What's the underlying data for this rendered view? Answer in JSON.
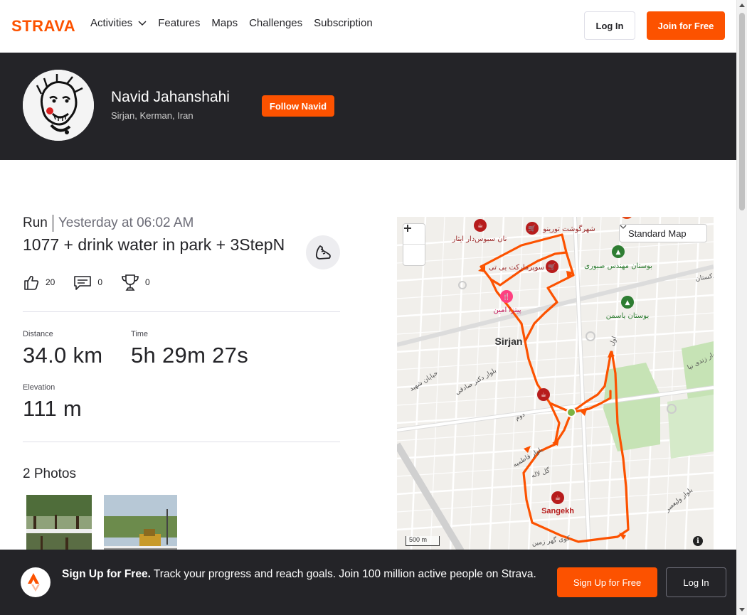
{
  "header": {
    "logo_text": "STRAVA",
    "nav": [
      "Activities",
      "Features",
      "Maps",
      "Challenges",
      "Subscription"
    ],
    "login_label": "Log In",
    "join_label": "Join for Free"
  },
  "athlete": {
    "name": "Navid Jahanshahi",
    "location": "Sirjan, Kerman, Iran",
    "follow_label": "Follow Navid"
  },
  "activity": {
    "type": "Run",
    "time": "Yesterday at 06:02 AM",
    "title": "1077 + drink water in park + 3StepN",
    "kudos": "20",
    "comments": "0",
    "achievements": "0",
    "stats": {
      "distance_label": "Distance",
      "distance_value": "34.0 km",
      "time_label": "Time",
      "time_value": "5h 29m 27s",
      "elevation_label": "Elevation",
      "elevation_value": "111 m"
    },
    "photos_title": "2 Photos"
  },
  "map": {
    "type_label": "Standard Map",
    "scale_label": "500 m",
    "city_label": "Sirjan",
    "sangekh_label": "Sangekh",
    "route_color": "#fc5200",
    "labels_fa": {
      "nan": "نان سبوس‌دار ایثار",
      "shahr_gosht": "شهرگوشت تورینو",
      "super": "سوپرمارکت بی تی",
      "bustan_saburi": "بوستان مهندس صبوری",
      "pizza": "پیتزا امین",
      "bustan_yasaman": "بوستان یاسمن",
      "shahid": "خیابان شهید",
      "sadeghi": "بلوار دکتر صادقی",
      "zandi": "بلوار زندی نیا",
      "fatemieh": "بلوار فاطمیه",
      "gol": "گل لاله",
      "gohar": "کوی گهر زمین",
      "valiasr": "بلوار ولیعصر",
      "dorm": "دوم",
      "avval": "اول",
      "kudakestan": "کودکستان"
    }
  },
  "signup": {
    "bold": "Sign Up for Free.",
    "text": " Track your progress and reach goals. Join 100 million active people on Strava.",
    "signup_label": "Sign Up for Free",
    "login_label": "Log In"
  },
  "colors": {
    "brand": "#fc5200",
    "dark": "#242428"
  }
}
